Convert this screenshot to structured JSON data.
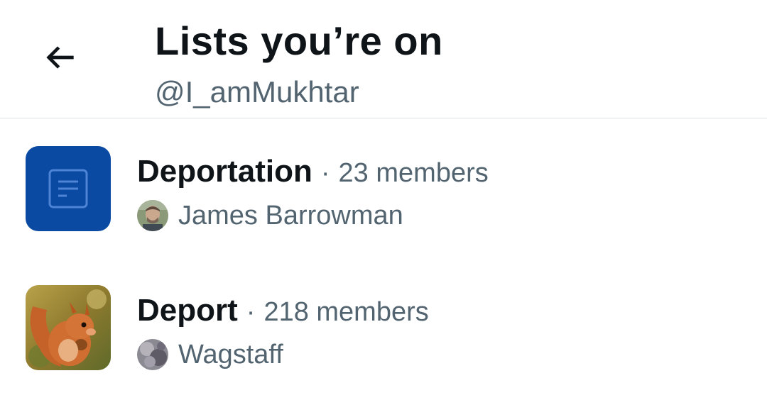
{
  "header": {
    "title": "Lists you’re on",
    "handle": "@I_amMukhtar",
    "back_icon": "arrow-left-icon"
  },
  "lists": [
    {
      "name": "Deportation",
      "separator": "·",
      "members": "23 members",
      "owner": "James Barrowman",
      "thumb_icon": "list-document-icon",
      "thumb_color": "#0b4aa2"
    },
    {
      "name": "Deport",
      "separator": "·",
      "members": "218 members",
      "owner": "Wagstaff",
      "thumb_icon": "squirrel-photo"
    }
  ],
  "colors": {
    "text_primary": "#0f1419",
    "text_secondary": "#536471",
    "divider": "#dde3e8"
  }
}
